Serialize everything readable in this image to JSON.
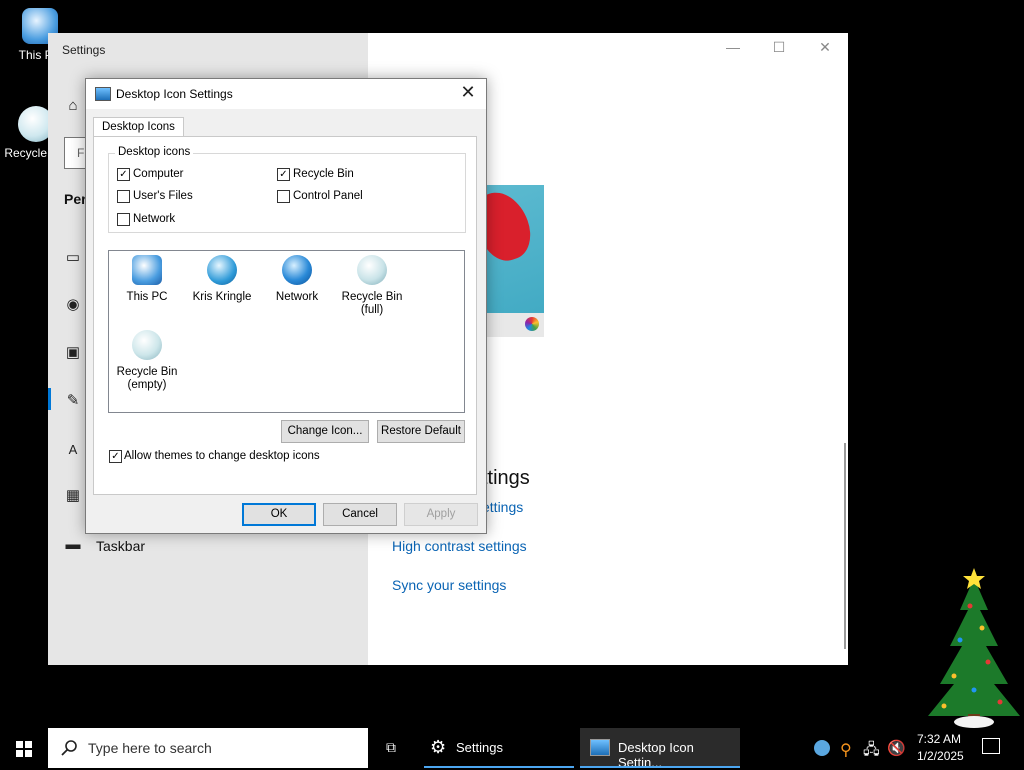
{
  "desktop": {
    "icons": [
      {
        "label": "This PC",
        "icon": "this-pc-icon"
      },
      {
        "label": "Recycle Bin",
        "icon": "recycle-bin-icon"
      }
    ]
  },
  "settings_window": {
    "title": "Settings",
    "search_placeholder": "Fi",
    "section": "Per",
    "nav_taskbar": "Taskbar",
    "heading": "ttings",
    "links": [
      "ettings",
      "High contrast settings",
      "Sync your settings"
    ],
    "controls": {
      "minimize": "—",
      "maximize": "☐",
      "close": "✕"
    }
  },
  "dialog": {
    "title": "Desktop Icon Settings",
    "close": "✕",
    "tab": "Desktop Icons",
    "group_label": "Desktop icons",
    "checkboxes": [
      {
        "label": "Computer",
        "checked": true
      },
      {
        "label": "Recycle Bin",
        "checked": true
      },
      {
        "label": "User's Files",
        "checked": false
      },
      {
        "label": "Control Panel",
        "checked": false
      },
      {
        "label": "Network",
        "checked": false
      }
    ],
    "icon_list": [
      {
        "label": "This PC",
        "icon": "monitor-icon"
      },
      {
        "label": "Kris Kringle",
        "icon": "user-icon"
      },
      {
        "label": "Network",
        "icon": "globe-icon"
      },
      {
        "label": "Recycle Bin (full)",
        "line1": "Recycle Bin",
        "line2": "(full)",
        "icon": "recycle-full-icon"
      },
      {
        "label": "Recycle Bin (empty)",
        "line1": "Recycle Bin",
        "line2": "(empty)",
        "icon": "recycle-empty-icon"
      }
    ],
    "change_icon": "Change Icon...",
    "restore_default": "Restore Default",
    "allow_themes": {
      "label": "Allow themes to change desktop icons",
      "checked": true
    },
    "ok": "OK",
    "cancel": "Cancel",
    "apply": "Apply"
  },
  "taskbar": {
    "search_placeholder": "Type here to search",
    "apps": [
      {
        "label": "Settings",
        "icon": "gear-icon"
      },
      {
        "label": "Desktop Icon Settin...",
        "icon": "desktop-settings-icon"
      }
    ],
    "time": "7:32 AM",
    "date": "1/2/2025"
  },
  "colors": {
    "accent": "#0078d7",
    "link": "#0a64b4",
    "settings_sidebar": "#e6e6e6"
  }
}
